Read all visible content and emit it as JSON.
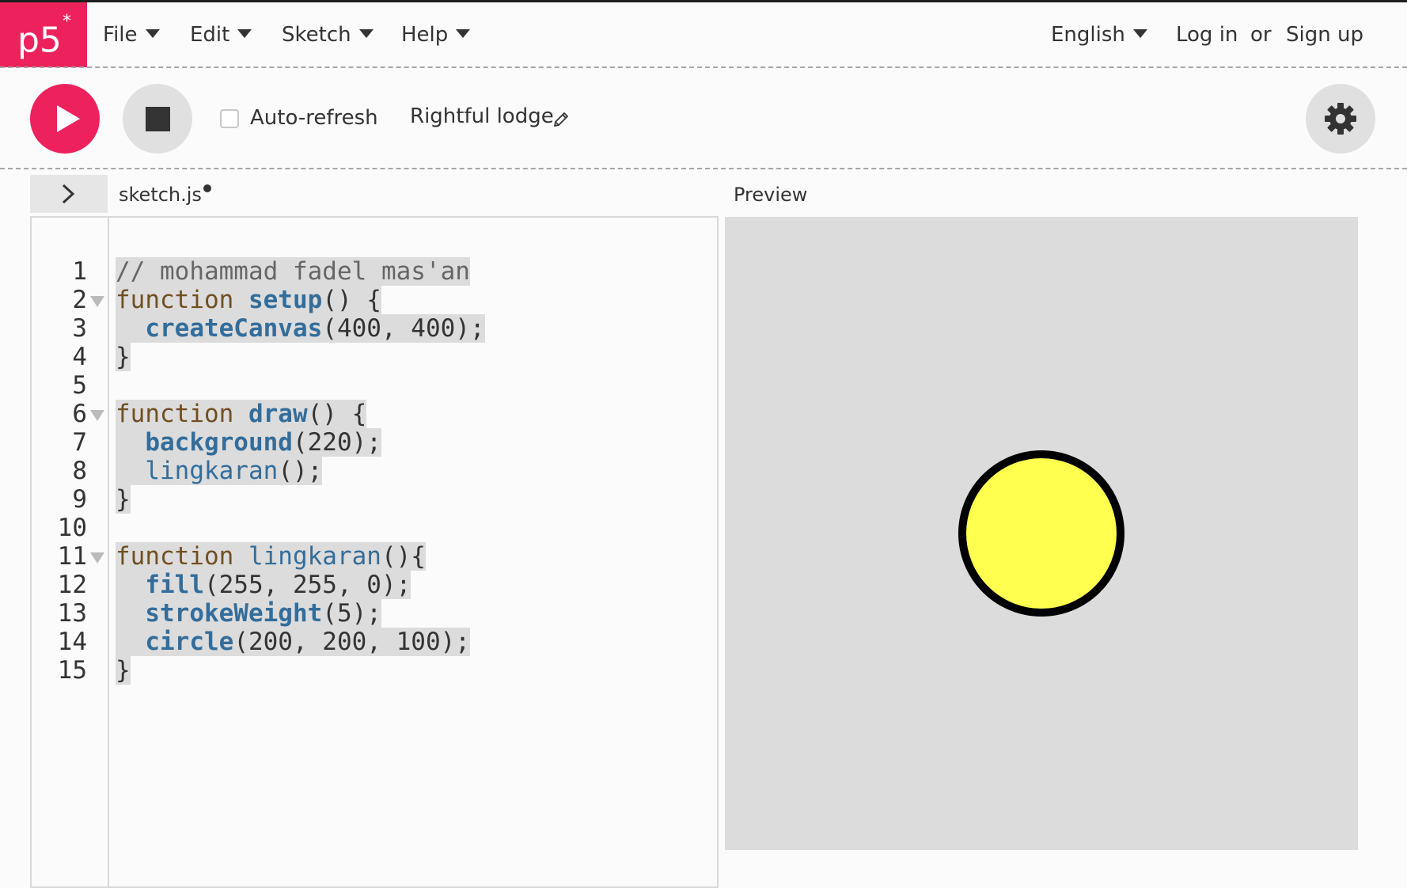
{
  "app": {
    "logo_text": "p5",
    "logo_superscript": "*",
    "brand_color": "#ed225d"
  },
  "nav": {
    "menus": [
      "File",
      "Edit",
      "Sketch",
      "Help"
    ],
    "language": "English",
    "login": "Log in",
    "or": "or",
    "signup": "Sign up"
  },
  "toolbar": {
    "play_icon": "play-icon",
    "stop_icon": "stop-icon",
    "auto_refresh_label": "Auto-refresh",
    "auto_refresh_checked": false,
    "sketch_name": "Rightful lodge",
    "edit_icon": "pencil-icon",
    "settings_icon": "gear-icon"
  },
  "editor": {
    "sidebar_toggle_icon": "chevron-right-icon",
    "file_tab": "sketch.js",
    "unsaved_dot": true,
    "lines": [
      {
        "n": "1",
        "fold": false,
        "tokens": [
          {
            "t": "comment",
            "v": "// mohammad fadel mas'an"
          }
        ]
      },
      {
        "n": "2",
        "fold": true,
        "tokens": [
          {
            "t": "keyword",
            "v": "function "
          },
          {
            "t": "def",
            "v": "setup"
          },
          {
            "t": "plain",
            "v": "() {"
          }
        ]
      },
      {
        "n": "3",
        "fold": false,
        "tokens": [
          {
            "t": "plain",
            "v": "  "
          },
          {
            "t": "builtin",
            "v": "createCanvas"
          },
          {
            "t": "plain",
            "v": "(400, 400);"
          }
        ]
      },
      {
        "n": "4",
        "fold": false,
        "tokens": [
          {
            "t": "plain",
            "v": "}"
          }
        ]
      },
      {
        "n": "5",
        "fold": false,
        "tokens": []
      },
      {
        "n": "6",
        "fold": true,
        "tokens": [
          {
            "t": "keyword",
            "v": "function "
          },
          {
            "t": "def",
            "v": "draw"
          },
          {
            "t": "plain",
            "v": "() {"
          }
        ]
      },
      {
        "n": "7",
        "fold": false,
        "tokens": [
          {
            "t": "plain",
            "v": "  "
          },
          {
            "t": "builtin",
            "v": "background"
          },
          {
            "t": "plain",
            "v": "(220);"
          }
        ]
      },
      {
        "n": "8",
        "fold": false,
        "tokens": [
          {
            "t": "plain",
            "v": "  "
          },
          {
            "t": "fn",
            "v": "lingkaran"
          },
          {
            "t": "plain",
            "v": "();"
          }
        ]
      },
      {
        "n": "9",
        "fold": false,
        "tokens": [
          {
            "t": "plain",
            "v": "}"
          }
        ]
      },
      {
        "n": "10",
        "fold": false,
        "tokens": []
      },
      {
        "n": "11",
        "fold": true,
        "tokens": [
          {
            "t": "keyword",
            "v": "function "
          },
          {
            "t": "fn",
            "v": "lingkaran"
          },
          {
            "t": "plain",
            "v": "(){"
          }
        ]
      },
      {
        "n": "12",
        "fold": false,
        "tokens": [
          {
            "t": "plain",
            "v": "  "
          },
          {
            "t": "builtin",
            "v": "fill"
          },
          {
            "t": "plain",
            "v": "(255, 255, 0);"
          }
        ]
      },
      {
        "n": "13",
        "fold": false,
        "tokens": [
          {
            "t": "plain",
            "v": "  "
          },
          {
            "t": "builtin",
            "v": "strokeWeight"
          },
          {
            "t": "plain",
            "v": "(5);"
          }
        ]
      },
      {
        "n": "14",
        "fold": false,
        "tokens": [
          {
            "t": "plain",
            "v": "  "
          },
          {
            "t": "builtin",
            "v": "circle"
          },
          {
            "t": "plain",
            "v": "(200, 200, 100);"
          }
        ]
      },
      {
        "n": "15",
        "fold": false,
        "tokens": [
          {
            "t": "plain",
            "v": "}"
          }
        ]
      }
    ]
  },
  "preview": {
    "label": "Preview",
    "canvas_background": "#dcdcdc",
    "circle_fill": "#ffff50",
    "circle_stroke": "#000000"
  }
}
